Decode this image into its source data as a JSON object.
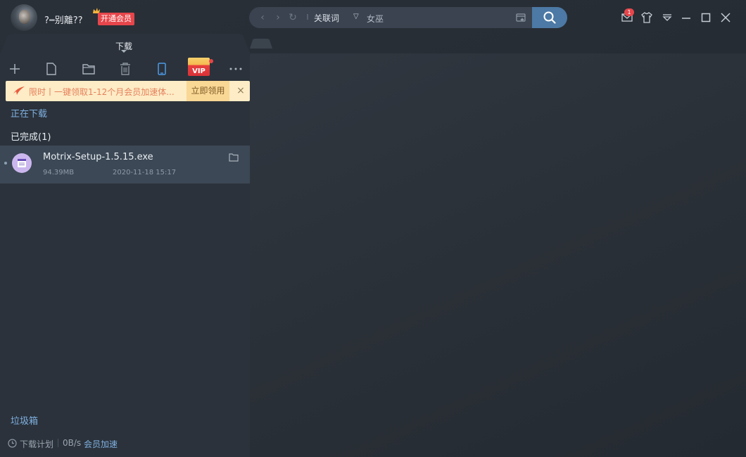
{
  "user": {
    "name": "?┅别離??",
    "vip_button": "开通会员"
  },
  "search": {
    "mode": "关联词",
    "value": "女巫",
    "mail_count": "1"
  },
  "tabs": {
    "active": "下载"
  },
  "toolbar": {
    "vip_label": "VIP"
  },
  "promo": {
    "text": "限时丨一键领取1-12个月会员加速体...",
    "claim_label": "立即领用",
    "close": "×"
  },
  "sections": {
    "downloading": "正在下载",
    "completed": "已完成(1)",
    "trash": "垃圾箱"
  },
  "downloads": [
    {
      "name": "Motrix-Setup-1.5.15.exe",
      "size": "94.39MB",
      "date": "2020-11-18 15:17"
    }
  ],
  "footer": {
    "plan": "下载计划",
    "speed": "0B/s",
    "accelerate": "会员加速"
  },
  "colors": {
    "accent": "#4c79a5",
    "vip_red": "#e6464b",
    "link_blue": "#7fb0e0",
    "panel": "#2b323b"
  }
}
